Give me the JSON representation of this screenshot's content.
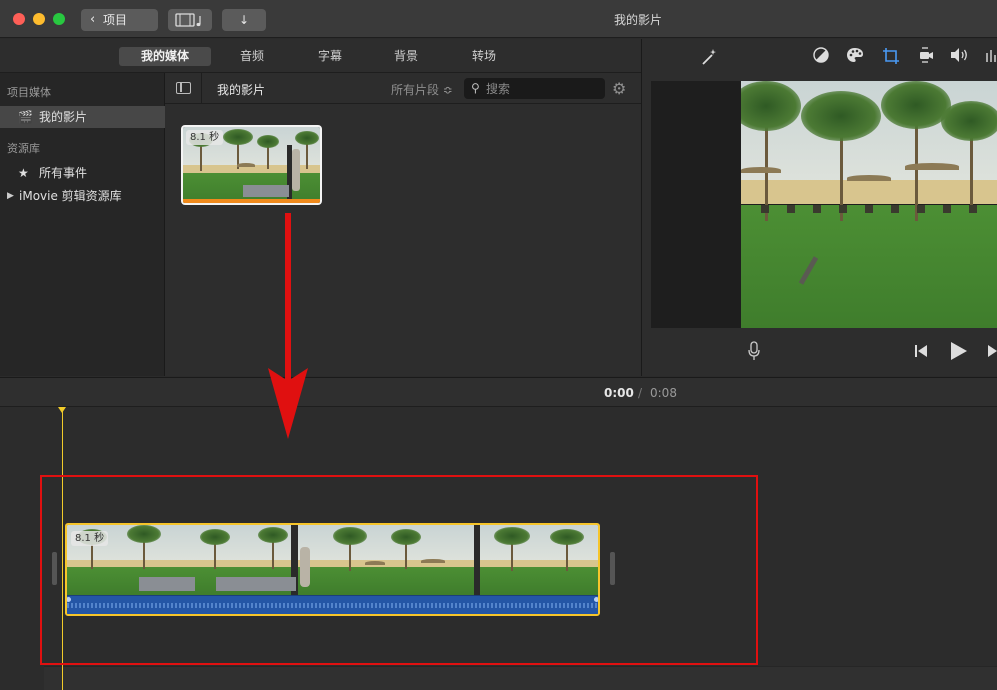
{
  "window": {
    "title": "我的影片"
  },
  "toolbar": {
    "back_label": "项目",
    "media_label": "",
    "import_label": "↓"
  },
  "tabs": [
    {
      "label": "我的媒体",
      "active": true
    },
    {
      "label": "音频",
      "active": false
    },
    {
      "label": "字幕",
      "active": false
    },
    {
      "label": "背景",
      "active": false
    },
    {
      "label": "转场",
      "active": false
    }
  ],
  "sidebar": {
    "section1": "项目媒体",
    "item_project": "我的影片",
    "section2": "资源库",
    "item_events": "所有事件",
    "item_library": "iMovie 剪辑资源库"
  },
  "browser": {
    "title": "我的影片",
    "filter": "所有片段 ≎",
    "search_placeholder": "搜索",
    "clip_duration": "8.1 秒"
  },
  "viewer": {
    "tools": [
      "magic-wand-icon",
      "color-balance-icon",
      "color-correction-icon",
      "crop-icon",
      "stabilization-icon",
      "volume-icon",
      "equalizer-icon"
    ]
  },
  "timeline": {
    "current_time": "0:00",
    "separator": "/",
    "total_time": "0:08",
    "clip_duration": "8.1 秒"
  },
  "colors": {
    "accent": "#4a9af4",
    "playhead": "#f2cc2a",
    "clip_border": "#f6c52b",
    "annotation": "#e01010",
    "audio": "#2456a6"
  }
}
